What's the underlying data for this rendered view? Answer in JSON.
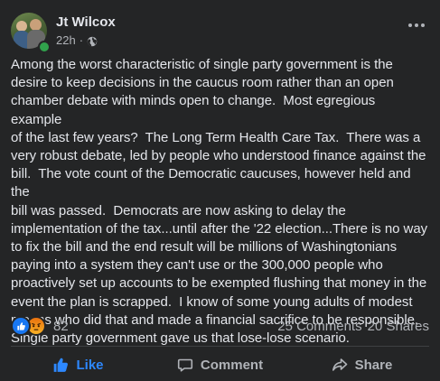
{
  "post": {
    "author": "Jt Wilcox",
    "time": "22h",
    "separator": "·",
    "privacy_icon": "globe-icon",
    "more_icon": "more-horizontal-icon",
    "text": "Among the worst characteristic of single party government is the\ndesire to keep decisions in the caucus room rather than an open\nchamber debate with minds open to change.  Most egregious example\nof the last few years?  The Long Term Health Care Tax.  There was a\nvery robust debate, led by people who understood finance against the\nbill.  The vote count of the Democratic caucuses, however held and the\nbill was passed.  Democrats are now asking to delay the\nimplementation of the tax...until after the '22 election...There is no way\nto fix the bill and the end result will be millions of Washingtonians\npaying into a system they can't use or the 300,000 people who\nproactively set up accounts to be exempted flushing that money in the\nevent the plan is scrapped.  I know of some young adults of modest\nmeans who did that and made a financial sacrifice to be responsible.\nSingle party government gave us that lose-lose scenario."
  },
  "stats": {
    "reactions": [
      "like-reaction-icon",
      "angry-reaction-icon"
    ],
    "reaction_count": "82",
    "comments": "25 Comments",
    "shares": "20 Shares"
  },
  "actions": {
    "like": "Like",
    "comment": "Comment",
    "share": "Share"
  },
  "colors": {
    "background": "#242526",
    "text": "#e4e6eb",
    "secondary_text": "#b0b3b8",
    "like_blue": "#2d88ff",
    "online_green": "#31a24c",
    "divider": "#3e4042"
  }
}
